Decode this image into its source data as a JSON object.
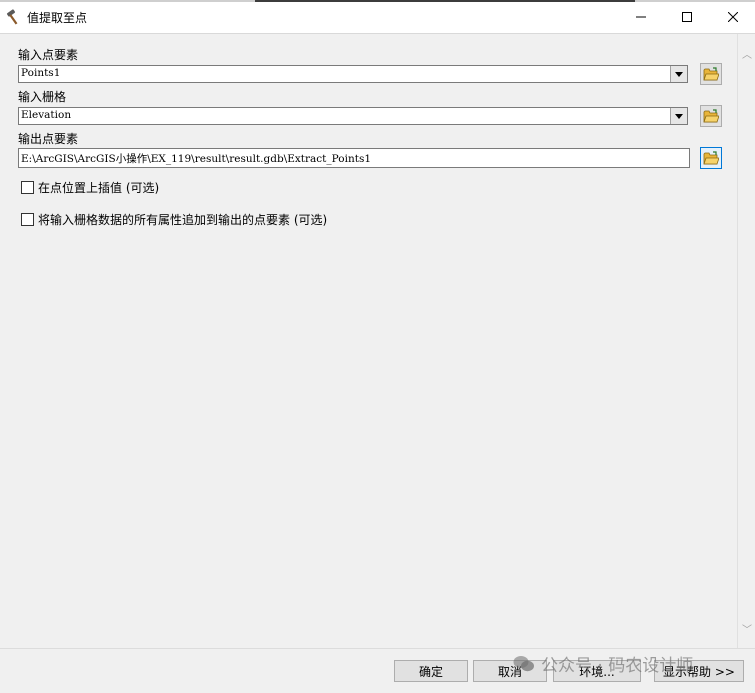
{
  "window": {
    "title": "值提取至点",
    "minimize_glyph": "—",
    "maximize_glyph": "☐",
    "close_glyph": "✕"
  },
  "form": {
    "input_points": {
      "label": "输入点要素",
      "value": "Points1"
    },
    "input_raster": {
      "label": "输入栅格",
      "value": "Elevation"
    },
    "output_points": {
      "label": "输出点要素",
      "value": "E:\\ArcGIS\\ArcGIS小操作\\EX_119\\result\\result.gdb\\Extract_Points1"
    },
    "interpolate": {
      "label": "在点位置上插值 (可选)",
      "checked": false
    },
    "append_attrs": {
      "label": "将输入栅格数据的所有属性追加到输出的点要素 (可选)",
      "checked": false
    }
  },
  "buttons": {
    "ok": "确定",
    "cancel": "取消",
    "environments": "环境...",
    "show_help": "显示帮助 >>"
  },
  "watermark": {
    "text": "公众号 · 码农设计师"
  },
  "icons": {
    "app": "hammer-icon",
    "folder": "open-folder-icon",
    "dropdown": "triangle-down-icon"
  },
  "colors": {
    "focus_border": "#0078d7",
    "background": "#f0f0f0"
  }
}
